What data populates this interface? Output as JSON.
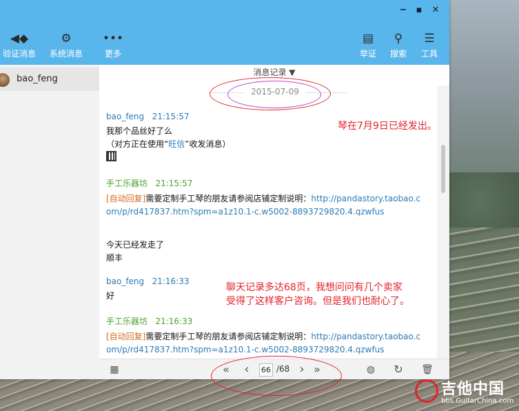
{
  "window_controls": {
    "minimize": "−",
    "maximize": "▪",
    "close": "✕"
  },
  "toolbar_left": [
    {
      "label": "验证消息",
      "icon": "speaker-icon"
    },
    {
      "label": "系统消息",
      "icon": "gear-icon"
    },
    {
      "label": "更多",
      "icon": "more-dots-icon"
    }
  ],
  "toolbar_right": [
    {
      "label": "举证",
      "icon": "document-icon"
    },
    {
      "label": "搜索",
      "icon": "search-icon"
    },
    {
      "label": "工具",
      "icon": "list-icon"
    }
  ],
  "sidebar": {
    "contact_name": "bao_feng"
  },
  "record_tab": "消息记录 ▼",
  "date": "2015-07-09",
  "messages": [
    {
      "sender": "bao_feng",
      "time": "21:15:57",
      "lines": [
        "我那个品丝好了么",
        "（对方正在使用“",
        "旺信",
        "”收发消息）"
      ]
    },
    {
      "sender": "手工乐器坊",
      "time": "21:15:57",
      "auto": "[自动回复]",
      "text": "需要定制手工琴的朋友请参阅店铺定制说明：",
      "link": "http://pandastory.taobao.c",
      "link2": "om/p/rd417837.htm?spm=a1z10.1-c.w5002-8893729820.4.qzwfus"
    },
    {
      "lines": [
        "今天已经发走了",
        "顺丰"
      ]
    },
    {
      "sender": "bao_feng",
      "time": "21:16:33",
      "lines": [
        "好"
      ]
    },
    {
      "sender": "手工乐器坊",
      "time": "21:16:33",
      "auto": "[自动回复]",
      "text": "需要定制手工琴的朋友请参阅店铺定制说明：",
      "link": "http://pandastory.taobao.c",
      "link2": "om/p/rd417837.htm?spm=a1z10.1-c.w5002-8893729820.4.qzwfus"
    }
  ],
  "pager": {
    "first": "«",
    "prev": "‹",
    "current": "66",
    "total": "/68",
    "next": "›",
    "last": "»"
  },
  "annotations": {
    "note1": "琴在7月9日已经发出。",
    "note2_line1": "聊天记录多达68页，我想问问有几个卖家",
    "note2_line2": "受得了这样客户咨询。但是我们也耐心了。"
  },
  "watermark": {
    "title": "吉他中国",
    "sub": "bbs.GuitarChina.com"
  },
  "colors": {
    "titlebar": "#59b6ec",
    "annotation": "#e2222a",
    "sender_blue": "#2b7ab3",
    "sender_green": "#49a12a"
  }
}
